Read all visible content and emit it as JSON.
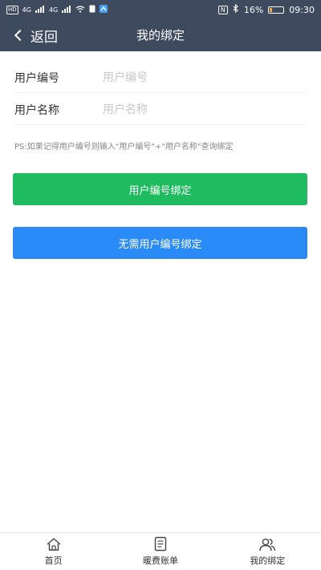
{
  "status_bar": {
    "carrier_badge": "HD",
    "network_1": "4G",
    "network_2": "4G",
    "nfc_mark": "N",
    "battery": "16%",
    "battery_level": 0.16,
    "time": "09:30"
  },
  "nav": {
    "back_label": "返回",
    "title": "我的绑定"
  },
  "form": {
    "user_no_label": "用户编号",
    "user_no_placeholder": "用户编号",
    "user_no_value": "",
    "user_name_label": "用户名称",
    "user_name_placeholder": "用户名称",
    "user_name_value": ""
  },
  "hint": "PS:如果记得用户编号则输入\"用户编号\"+\"用户名称\"查询绑定",
  "buttons": {
    "bind_with_no": "用户编号绑定",
    "bind_without_no": "无需用户编号绑定"
  },
  "colors": {
    "nav_bg": "#3e4a5e",
    "green": "#1fbc5f",
    "blue": "#2a8af6"
  },
  "tabs": [
    {
      "label": "首页",
      "icon": "home-icon"
    },
    {
      "label": "暖费账单",
      "icon": "bill-icon"
    },
    {
      "label": "我的绑定",
      "icon": "users-icon"
    }
  ]
}
